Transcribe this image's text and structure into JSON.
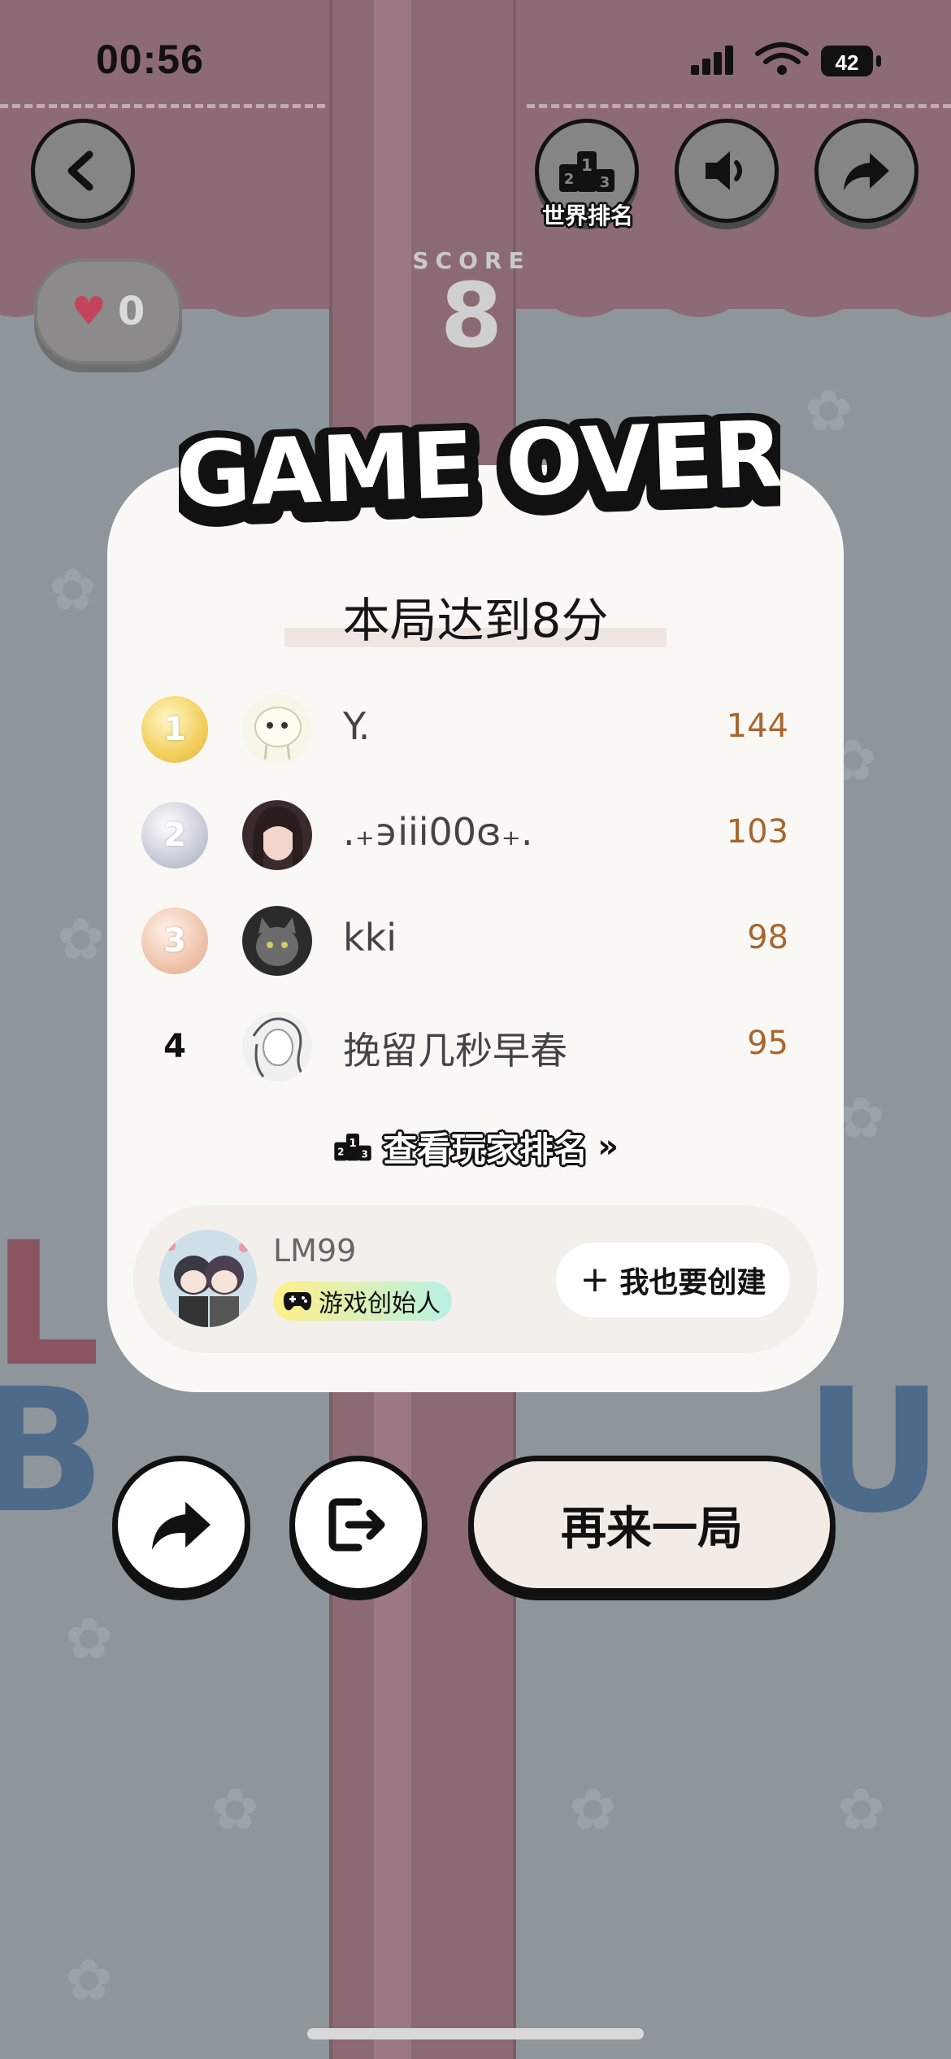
{
  "status_bar": {
    "time": "00:56",
    "battery": "42"
  },
  "top_bar": {
    "world_rank_label": "世界排名",
    "lives": "0",
    "score_label": "SCORE",
    "score": "8"
  },
  "game_over": {
    "title": "GAME OVER",
    "subtitle": "本局达到8分",
    "leaderboard": [
      {
        "rank": "1",
        "name": "Y.",
        "score": "144"
      },
      {
        "rank": "2",
        "name": ".₊϶iii00ɞ₊.",
        "score": "103"
      },
      {
        "rank": "3",
        "name": "kki",
        "score": "98"
      },
      {
        "rank": "4",
        "name": "挽留几秒早春",
        "score": "95"
      }
    ],
    "view_rank_label": "查看玩家排名",
    "view_rank_arrows": "»",
    "creator": {
      "name": "LM99",
      "badge": "游戏创始人",
      "create_plus": "+",
      "create_label": "我也要创建"
    }
  },
  "actions": {
    "replay_label": "再来一局"
  },
  "colors": {
    "card_bg": "#faf8f5",
    "score_text": "#a8662e",
    "overlay_bg": "#8e969c",
    "badge_gradient_start": "#fff08a",
    "badge_gradient_end": "#b8f0e4"
  }
}
